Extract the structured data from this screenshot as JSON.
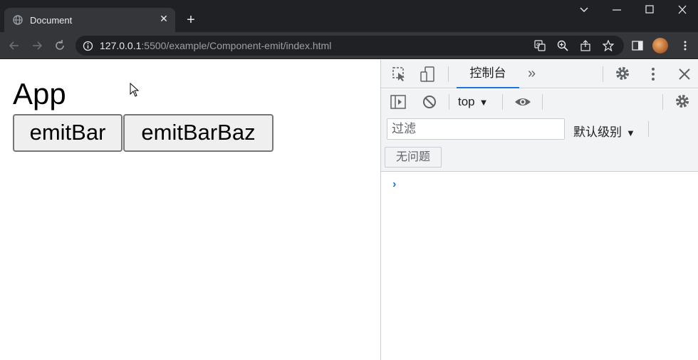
{
  "browser": {
    "tab": {
      "title": "Document",
      "close_glyph": "✕",
      "favicon": "globe-icon"
    },
    "new_tab_glyph": "+",
    "url_host": "127.0.0.1",
    "url_rest": ":5500/example/Component-emit/index.html",
    "window_controls": [
      "chevron-down-icon",
      "minimize-icon",
      "maximize-icon",
      "close-icon"
    ]
  },
  "page": {
    "title": "App",
    "buttons": [
      {
        "label": "emitBar"
      },
      {
        "label": "emitBarBaz"
      }
    ]
  },
  "devtools": {
    "tabs": [
      {
        "label": "控制台",
        "active": true
      }
    ],
    "more_tabs_glyph": "»",
    "context": "top",
    "dropdown_glyph": "▼",
    "filter_placeholder": "过滤",
    "levels": "默认级别",
    "issues": "无问题",
    "prompt_glyph": "›"
  },
  "colors": {
    "chrome_dark": "#202124",
    "chrome_toolbar": "#35363a",
    "devtools_bg": "#f1f3f4",
    "accent": "#1a73e8"
  }
}
